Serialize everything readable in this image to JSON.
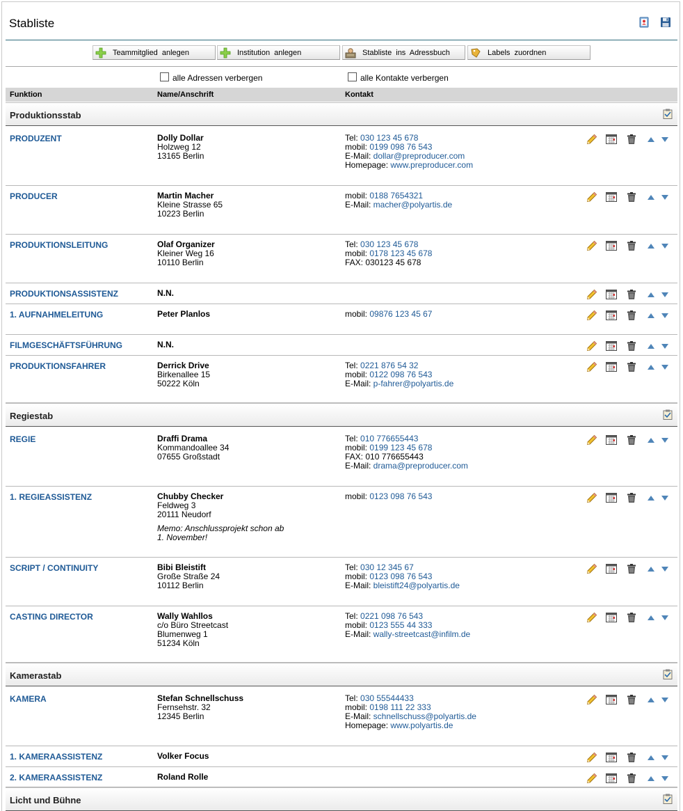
{
  "page_title": "Stabliste",
  "header_icons": [
    "address-book-icon",
    "save-disk-icon"
  ],
  "toolbar": [
    {
      "label": "Teammitglied anlegen",
      "icon": "add-plus-icon"
    },
    {
      "label": "Institution anlegen",
      "icon": "add-plus-icon"
    },
    {
      "label": "Stabliste ins Adressbuch",
      "icon": "address-book-person-icon"
    },
    {
      "label": "Labels zuordnen",
      "icon": "label-tag-icon"
    }
  ],
  "checkboxes": [
    {
      "label": "alle Adressen verbergen",
      "checked": false
    },
    {
      "label": "alle Kontakte verbergen",
      "checked": false
    }
  ],
  "columns": {
    "funktion": "Funktion",
    "name": "Name/Anschrift",
    "kontakt": "Kontakt"
  },
  "sections": [
    {
      "name": "Produktionsstab",
      "rows": [
        {
          "funktion": "PRODUZENT",
          "name": "Dolly Dollar",
          "address": [
            "Holzweg 12",
            "13165 Berlin"
          ],
          "contacts": [
            {
              "label": "Tel:",
              "value": "030 123 45 678"
            },
            {
              "label": "mobil:",
              "value": "0199 098 76 543"
            },
            {
              "label": "E-Mail:",
              "value": "dollar@preproducer.com"
            },
            {
              "label": "Homepage:",
              "value": "www.preproducer.com"
            }
          ]
        },
        {
          "funktion": "PRODUCER",
          "name": "Martin Macher",
          "address": [
            "Kleine Strasse 65",
            "10223 Berlin"
          ],
          "contacts": [
            {
              "label": "mobil:",
              "value": "0188 7654321"
            },
            {
              "label": "E-Mail:",
              "value": "macher@polyartis.de"
            }
          ]
        },
        {
          "funktion": "PRODUKTIONSLEITUNG",
          "name": "Olaf Organizer",
          "address": [
            "Kleiner Weg 16",
            "10110 Berlin"
          ],
          "contacts": [
            {
              "label": "Tel:",
              "value": "030 123 45 678"
            },
            {
              "label": "mobil:",
              "value": "0178 123 45 678"
            },
            {
              "label": "FAX: 030123 45 678",
              "value": ""
            }
          ]
        },
        {
          "funktion": "PRODUKTIONSASSISTENZ",
          "name": "N.N.",
          "address": [],
          "contacts": []
        },
        {
          "funktion": "1. AUFNAHMELEITUNG",
          "name": "Peter Planlos",
          "address": [],
          "contacts": [
            {
              "label": "mobil:",
              "value": "09876 123 45 67"
            }
          ]
        },
        {
          "funktion": "FILMGESCHÄFTSFÜHRUNG",
          "name": "N.N.",
          "address": [],
          "contacts": []
        },
        {
          "funktion": "PRODUKTIONSFAHRER",
          "name": "Derrick Drive",
          "address": [
            "Birkenallee 15",
            "50222 Köln"
          ],
          "contacts": [
            {
              "label": "Tel:",
              "value": "0221 876 54 32"
            },
            {
              "label": "mobil:",
              "value": "0122 098 76 543"
            },
            {
              "label": "E-Mail:",
              "value": "p-fahrer@polyartis.de"
            }
          ]
        }
      ]
    },
    {
      "name": "Regiestab",
      "rows": [
        {
          "funktion": "REGIE",
          "name": "Draffi Drama",
          "address": [
            "Kommandoallee 34",
            "07655 Großstadt"
          ],
          "contacts": [
            {
              "label": "Tel:",
              "value": "010 776655443"
            },
            {
              "label": "mobil:",
              "value": "0199 123 45 678"
            },
            {
              "label": "FAX: 010 776655443",
              "value": ""
            },
            {
              "label": "E-Mail:",
              "value": "drama@preproducer.com"
            }
          ]
        },
        {
          "funktion": "1. REGIEASSISTENZ",
          "name": "Chubby Checker",
          "address": [
            "Feldweg 3",
            "20111 Neudorf"
          ],
          "memo": [
            "Memo: Anschlussprojekt schon ab",
            "1. November!"
          ],
          "contacts": [
            {
              "label": "mobil:",
              "value": "0123 098 76 543"
            }
          ]
        },
        {
          "funktion": "SCRIPT / CONTINUITY",
          "name": "Bibi Bleistift",
          "address": [
            "Große Straße 24",
            "10112 Berlin"
          ],
          "contacts": [
            {
              "label": "Tel:",
              "value": "030 12 345 67"
            },
            {
              "label": "mobil:",
              "value": "0123 098 76 543"
            },
            {
              "label": "E-Mail:",
              "value": "bleistift24@polyartis.de"
            }
          ]
        },
        {
          "funktion": "CASTING DIRECTOR",
          "name": "Wally Wahllos",
          "address": [
            "c/o Büro Streetcast",
            "Blumenweg 1",
            "51234 Köln"
          ],
          "contacts": [
            {
              "label": "Tel:",
              "value": "0221 098 76 543"
            },
            {
              "label": "mobil:",
              "value": "0123 555 44 333"
            },
            {
              "label": "E-Mail:",
              "value": "wally-streetcast@infilm.de"
            }
          ]
        }
      ]
    },
    {
      "name": "Kamerastab",
      "rows": [
        {
          "funktion": "KAMERA",
          "name": "Stefan Schnellschuss",
          "address": [
            "Fernsehstr. 32",
            "12345 Berlin"
          ],
          "contacts": [
            {
              "label": "Tel:",
              "value": "030 55544433"
            },
            {
              "label": "mobil:",
              "value": "0198 111 22 333"
            },
            {
              "label": "E-Mail:",
              "value": "schnellschuss@polyartis.de"
            },
            {
              "label": "Homepage:",
              "value": "www.polyartis.de"
            }
          ]
        },
        {
          "funktion": "1. KAMERAASSISTENZ",
          "name": "Volker Focus",
          "address": [],
          "contacts": []
        },
        {
          "funktion": "2. KAMERAASSISTENZ",
          "name": "Roland Rolle",
          "address": [],
          "contacts": []
        }
      ]
    },
    {
      "name": "Licht und Bühne",
      "rows": []
    }
  ],
  "colors": {
    "link_blue": "#1f5a96",
    "header_rule": "#2e6b7c",
    "column_header_bg": "#d6d6d6",
    "arrow_blue": "#4f85b8"
  }
}
